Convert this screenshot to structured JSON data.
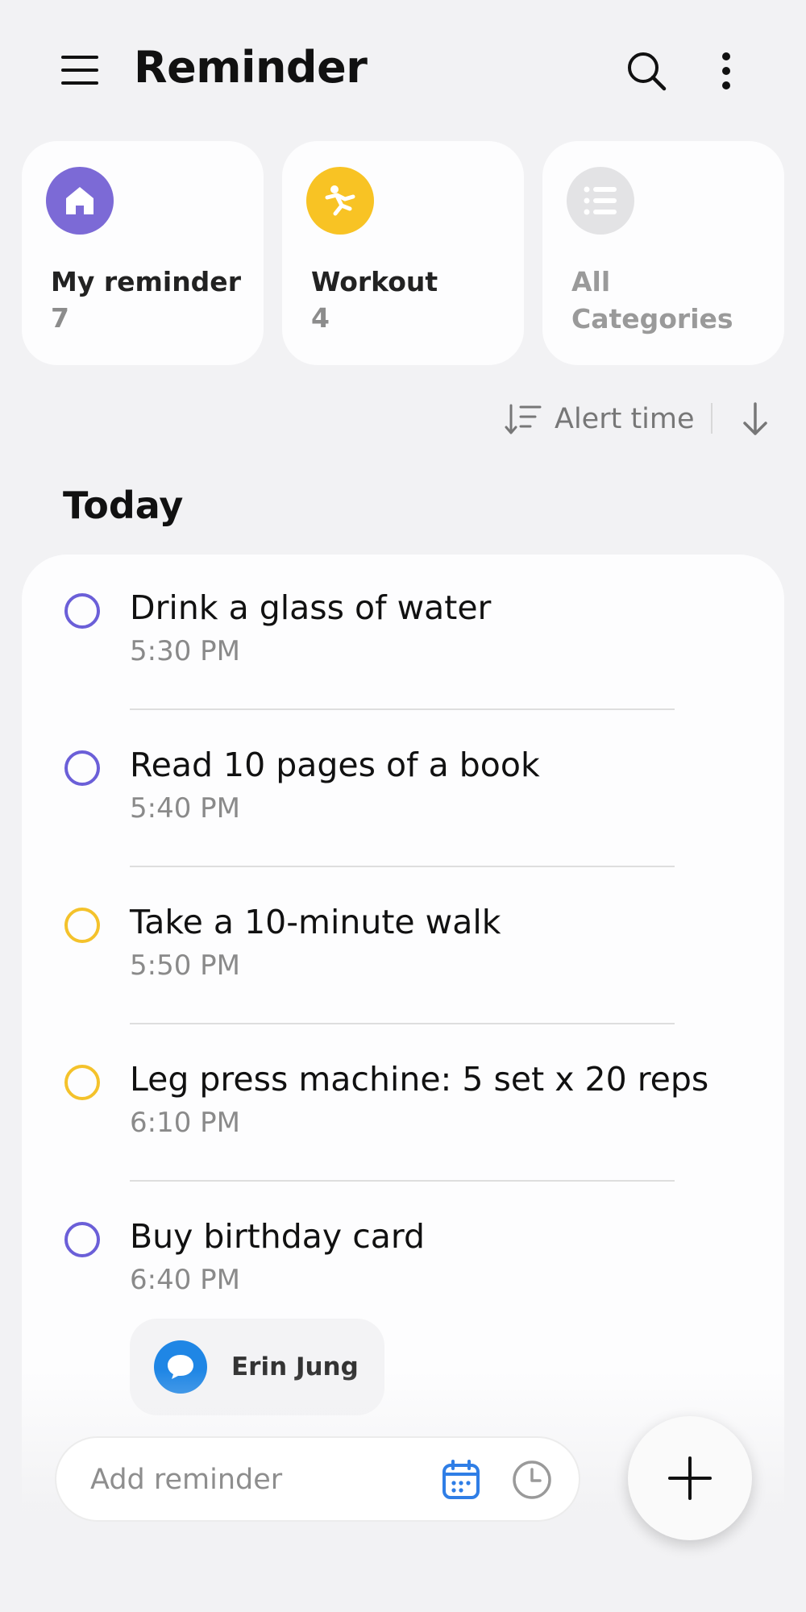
{
  "app": {
    "title": "Reminder"
  },
  "categories": [
    {
      "name": "My reminder",
      "count": "7",
      "icon": "home-icon",
      "color": "#7c6ad6"
    },
    {
      "name": "Workout",
      "count": "4",
      "icon": "workout-icon",
      "color": "#f8c324"
    },
    {
      "name": "All Categories",
      "count": "",
      "icon": "list-icon",
      "color": "#e3e3e5"
    }
  ],
  "sort": {
    "label": "Alert time",
    "direction_icon": "arrow-down-icon"
  },
  "today": {
    "title": "Today",
    "items": [
      {
        "title": "Drink a glass of water",
        "time": "5:30 PM",
        "category_color": "#6b5fd8"
      },
      {
        "title": "Read 10 pages of a book",
        "time": "5:40 PM",
        "category_color": "#6b5fd8"
      },
      {
        "title": "Take a 10-minute walk",
        "time": "5:50 PM",
        "category_color": "#f4c22b"
      },
      {
        "title": "Leg press machine: 5 set x 20 reps",
        "time": "6:10 PM",
        "category_color": "#f4c22b"
      },
      {
        "title": "Buy birthday card",
        "time": "6:40 PM",
        "category_color": "#6b5fd8",
        "contact": "Erin Jung"
      }
    ]
  },
  "composer": {
    "placeholder": "Add reminder",
    "value": ""
  }
}
